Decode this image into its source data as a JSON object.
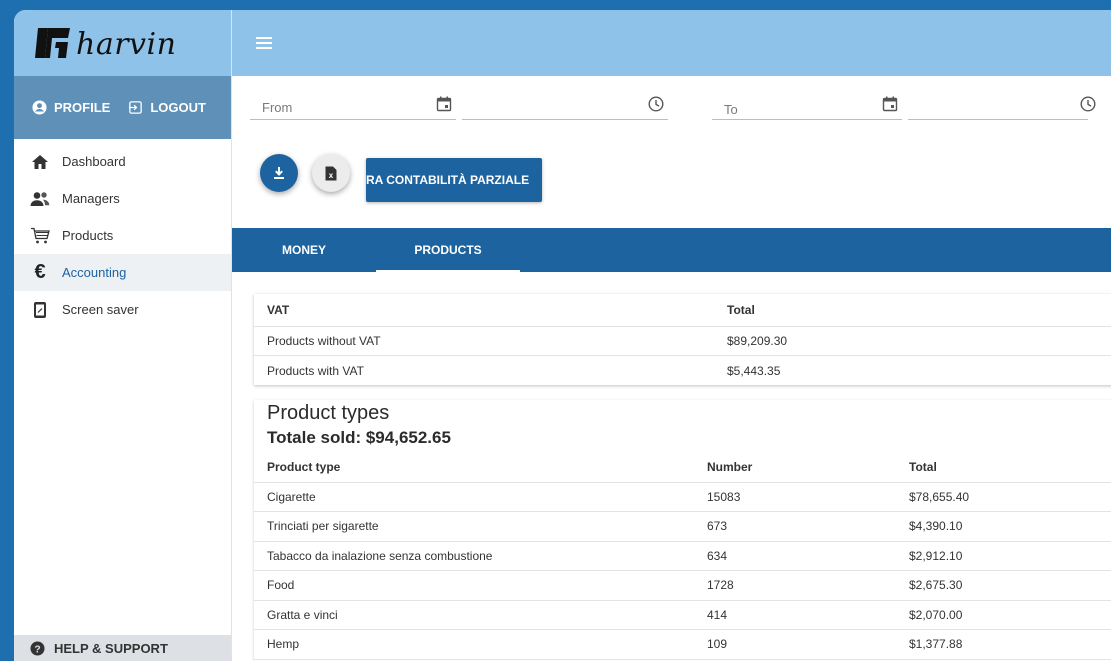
{
  "brand": {
    "logo_text": "harvin"
  },
  "profile": {
    "profile_label": "PROFILE",
    "logout_label": "LOGOUT"
  },
  "sidebar": {
    "items": [
      {
        "label": "Dashboard",
        "icon": "home-icon"
      },
      {
        "label": "Managers",
        "icon": "people-icon"
      },
      {
        "label": "Products",
        "icon": "cart-icon"
      },
      {
        "label": "Accounting",
        "icon": "euro-icon",
        "active": true
      },
      {
        "label": "Screen saver",
        "icon": "phone-screen-icon"
      }
    ],
    "help_label": "HELP & SUPPORT"
  },
  "filters": {
    "from_label": "From",
    "to_label": "To"
  },
  "actions": {
    "cta_label": "RA CONTABILITÀ PARZIALE"
  },
  "tabs": [
    {
      "label": "MONEY",
      "active": false
    },
    {
      "label": "PRODUCTS",
      "active": true
    }
  ],
  "vat_table": {
    "headers": [
      "VAT",
      "Total"
    ],
    "rows": [
      [
        "Products without VAT",
        "$89,209.30"
      ],
      [
        "Products with VAT",
        "$5,443.35"
      ]
    ]
  },
  "product_types": {
    "title": "Product types",
    "total_sold": "Totale sold: $94,652.65",
    "headers": [
      "Product type",
      "Number",
      "Total"
    ],
    "rows": [
      [
        "Cigarette",
        "15083",
        "$78,655.40"
      ],
      [
        "Trinciati per sigarette",
        "673",
        "$4,390.10"
      ],
      [
        "Tabacco da inalazione senza combustione",
        "634",
        "$2,912.10"
      ],
      [
        "Food",
        "1728",
        "$2,675.30"
      ],
      [
        "Gratta e vinci",
        "414",
        "$2,070.00"
      ],
      [
        "Hemp",
        "109",
        "$1,377.88"
      ]
    ]
  },
  "colors": {
    "primary": "#1c63a0",
    "header": "#8ec2e9",
    "profile_bar": "#5f90b8",
    "frame_bg": "#1e6fb0"
  }
}
